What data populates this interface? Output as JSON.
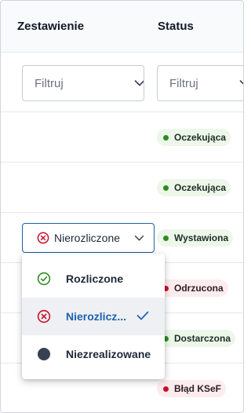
{
  "columns": {
    "summary": "Zestawienie",
    "status": "Status"
  },
  "filters": {
    "summary_placeholder": "Filtruj",
    "status_placeholder": "Filtruj"
  },
  "rows": [
    {
      "status": "Oczekująca",
      "status_color": "green"
    },
    {
      "status": "Oczekująca",
      "status_color": "green"
    },
    {
      "status": "Wystawiona",
      "status_color": "green"
    },
    {
      "status": "Odrzucona",
      "status_color": "red"
    },
    {
      "status": "Dostarczona",
      "status_color": "green"
    },
    {
      "status": "Błąd KSeF",
      "status_color": "red"
    }
  ],
  "summary_select": {
    "value": "Nierozliczone",
    "value_icon": "x-circle-icon"
  },
  "summary_menu": {
    "options": [
      {
        "label": "Rozliczone",
        "icon": "check-circle-icon",
        "selected": false
      },
      {
        "label": "Nierozlicz...",
        "icon": "x-circle-icon",
        "selected": true
      },
      {
        "label": "Niezrealizowane",
        "icon": "filled-circle-icon",
        "selected": false
      }
    ]
  },
  "colors": {
    "accent": "#1e62b0",
    "status_green": "#2e8b22",
    "status_red": "#c8102e",
    "icon_dark": "#374151"
  }
}
